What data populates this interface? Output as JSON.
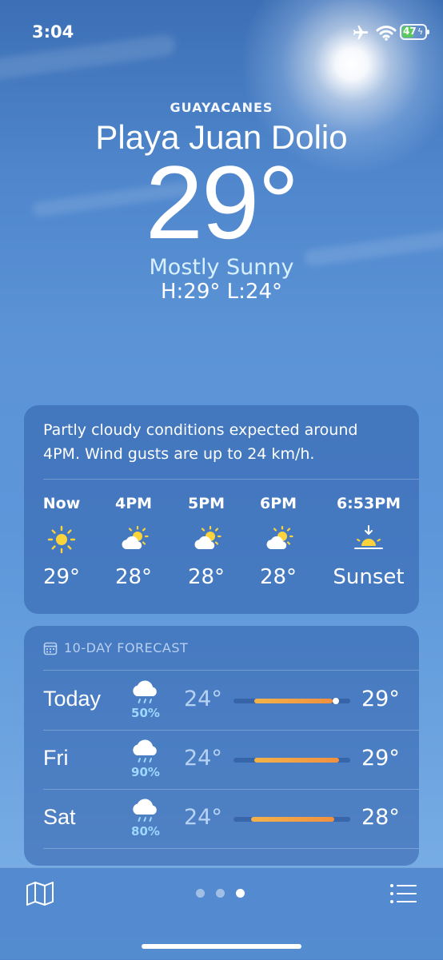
{
  "status": {
    "time": "3:04",
    "battery": "47"
  },
  "location": {
    "area": "GUAYACANES",
    "city": "Playa Juan Dolio"
  },
  "current": {
    "temp": "29°",
    "condition": "Mostly Sunny",
    "hilo": "H:29°  L:24°"
  },
  "hourly": {
    "summary": "Partly cloudy conditions expected around 4PM. Wind gusts are up to 24 km/h.",
    "items": [
      {
        "time": "Now",
        "icon": "sun-icon",
        "temp": "29°"
      },
      {
        "time": "4PM",
        "icon": "partly-cloudy-icon",
        "temp": "28°"
      },
      {
        "time": "5PM",
        "icon": "partly-cloudy-icon",
        "temp": "28°"
      },
      {
        "time": "6PM",
        "icon": "partly-cloudy-icon",
        "temp": "28°"
      },
      {
        "time": "6:53PM",
        "icon": "sunset-icon",
        "temp": "Sunset"
      }
    ]
  },
  "forecast": {
    "title": "10-DAY FORECAST",
    "days": [
      {
        "day": "Today",
        "icon": "rain-cloud-icon",
        "chance": "50%",
        "low": "24°",
        "high": "29°"
      },
      {
        "day": "Fri",
        "icon": "rain-cloud-icon",
        "chance": "90%",
        "low": "24°",
        "high": "29°"
      },
      {
        "day": "Sat",
        "icon": "rain-cloud-icon",
        "chance": "80%",
        "low": "24°",
        "high": "28°"
      }
    ]
  },
  "pager": {
    "pages": 3,
    "current": 3
  }
}
